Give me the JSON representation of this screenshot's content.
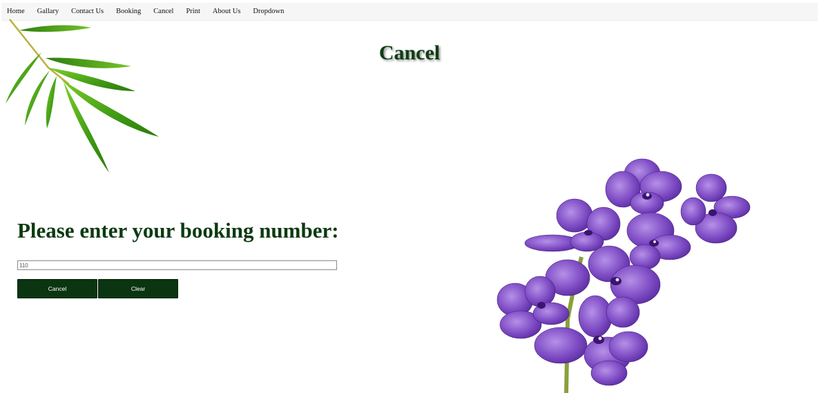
{
  "nav": {
    "items": [
      {
        "label": "Home",
        "name": "nav-home"
      },
      {
        "label": "Gallary",
        "name": "nav-gallary"
      },
      {
        "label": "Contact Us",
        "name": "nav-contact-us"
      },
      {
        "label": "Booking",
        "name": "nav-booking"
      },
      {
        "label": "Cancel",
        "name": "nav-cancel"
      },
      {
        "label": "Print",
        "name": "nav-print"
      },
      {
        "label": "About Us",
        "name": "nav-about-us"
      },
      {
        "label": "Dropdown",
        "name": "nav-dropdown"
      }
    ]
  },
  "page": {
    "title": "Cancel",
    "prompt": "Please enter your booking number:"
  },
  "form": {
    "booking_number_value": "110",
    "cancel_label": "Cancel",
    "clear_label": "Clear"
  },
  "colors": {
    "heading": "#0f3d12",
    "button_bg": "#0b3510",
    "nav_bg": "#f6f6f7"
  },
  "images": {
    "top_left": "bamboo-leaves",
    "bottom_right": "purple-orchid"
  }
}
